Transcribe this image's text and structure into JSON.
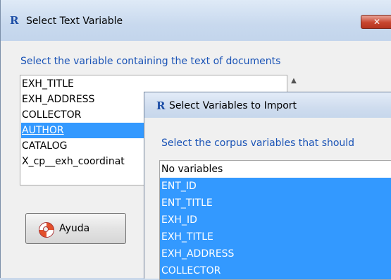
{
  "dialog1": {
    "title": "Select Text Variable",
    "app_icon": "R",
    "close_glyph": "✕",
    "prompt": "Select the variable containing the text of documents",
    "variables": [
      "EXH_TITLE",
      "EXH_ADDRESS",
      "COLLECTOR",
      "AUTHOR",
      "CATALOG",
      "X_cp__exh_coordinat"
    ],
    "selected": "AUTHOR",
    "help_button": "Ayuda"
  },
  "dialog2": {
    "title": "Select Variables to Import",
    "app_icon": "R",
    "prompt": "Select the corpus variables that should",
    "variables": [
      "No variables",
      "ENT_ID",
      "ENT_TITLE",
      "EXH_ID",
      "EXH_TITLE",
      "EXH_ADDRESS",
      "COLLECTOR"
    ],
    "selected": [
      "ENT_ID",
      "ENT_TITLE",
      "EXH_ID",
      "EXH_TITLE",
      "EXH_ADDRESS",
      "COLLECTOR"
    ]
  },
  "colors": {
    "selection": "#3399ff",
    "prompt_text": "#1a53b6"
  }
}
